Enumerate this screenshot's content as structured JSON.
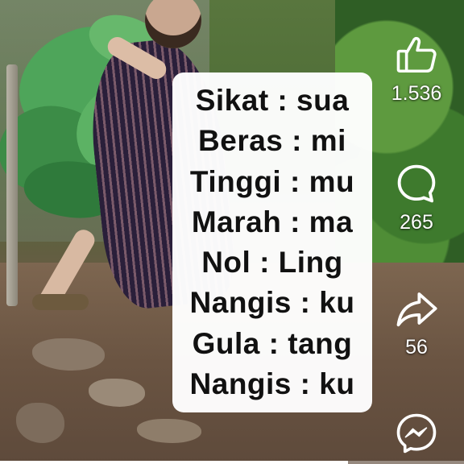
{
  "text_card": {
    "lines": [
      "Sikat : sua",
      "Beras : mi",
      "Tinggi : mu",
      "Marah : ma",
      "Nol : Ling",
      "Nangis : ku",
      "Gula : tang",
      "Nangis : ku"
    ]
  },
  "actions": {
    "like": {
      "icon": "thumbs-up-icon",
      "count": "1.536"
    },
    "comment": {
      "icon": "comment-bubble-icon",
      "count": "265"
    },
    "share": {
      "icon": "share-arrow-icon",
      "count": "56"
    },
    "messenger": {
      "icon": "messenger-icon"
    }
  },
  "colors": {
    "icon": "#ffffff",
    "card": "#ffffff",
    "card_text": "#111111"
  },
  "playback": {
    "progress": 0.75
  }
}
